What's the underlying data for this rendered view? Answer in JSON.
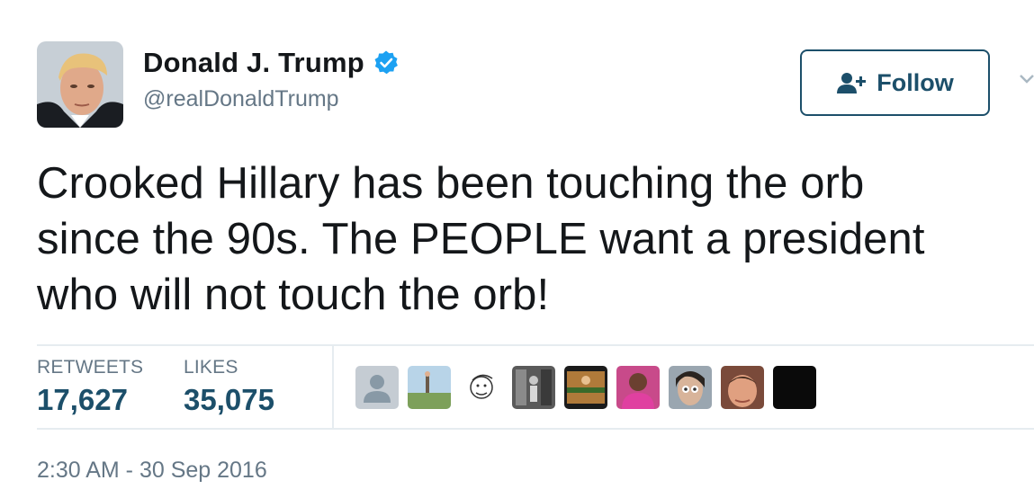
{
  "user": {
    "display_name": "Donald J. Trump",
    "handle": "@realDonaldTrump",
    "verified": true,
    "avatar_icon": "profile-photo"
  },
  "follow_button": {
    "label": "Follow",
    "icon": "add-user-icon",
    "color": "#1c4f6a"
  },
  "tweet": {
    "lines": [
      "Crooked Hillary has been touching the orb",
      "since the 90s. The PEOPLE want a president",
      "who will not touch the orb!"
    ]
  },
  "stats": {
    "retweets_label": "RETWEETS",
    "retweets_value": "17,627",
    "likes_label": "LIKES",
    "likes_value": "35,075"
  },
  "timestamp": "2:30 AM - 30 Sep 2016",
  "colors": {
    "accent": "#1c4f6a",
    "verified": "#1da1f2",
    "muted": "#657786",
    "text": "#14171a",
    "divider": "#e6ecf0"
  }
}
